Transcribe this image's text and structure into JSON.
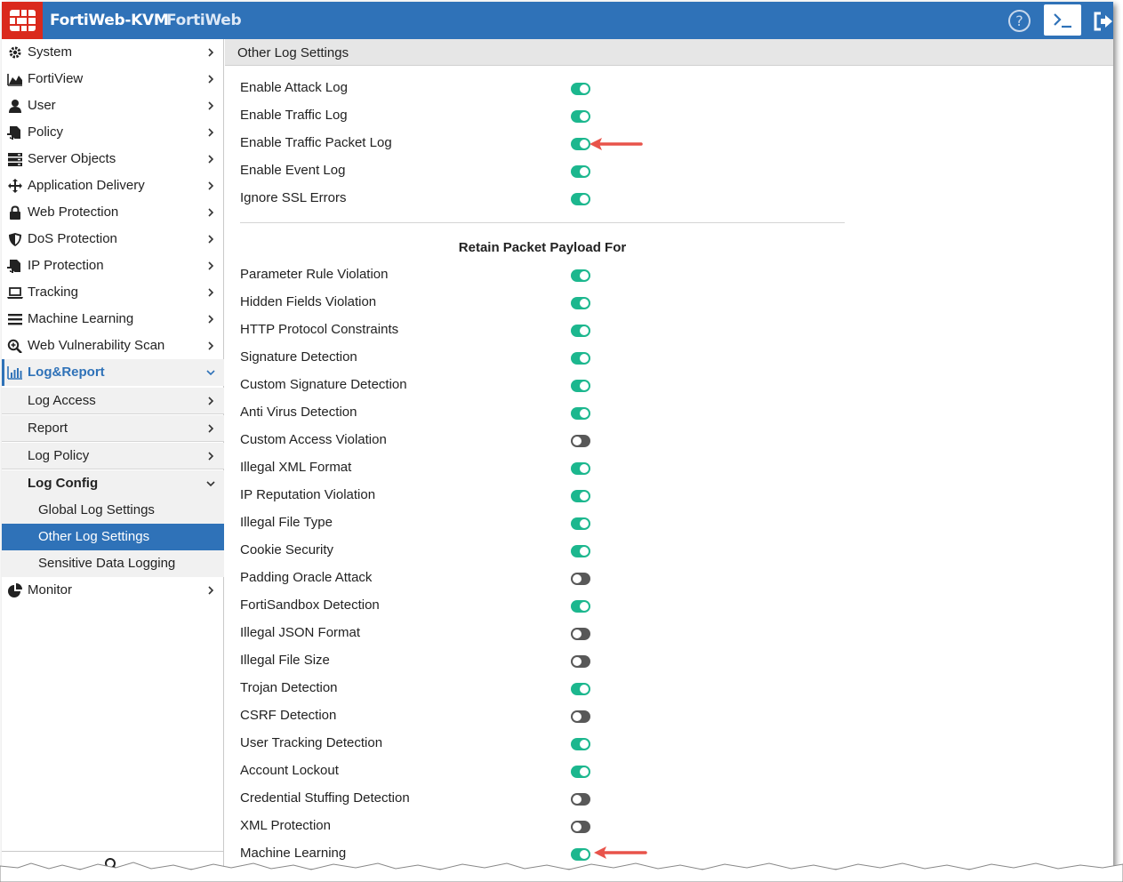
{
  "header": {
    "app_title": "FortiWeb-KVM",
    "app_sub": "FortiWeb",
    "help_glyph": "?",
    "colors": {
      "bar": "#2f72b8",
      "logo": "#da291c",
      "toggle_on": "#1cb78e",
      "toggle_off": "#585858",
      "selected": "#2f72b8"
    }
  },
  "sidebar": {
    "items": [
      {
        "label": "System",
        "icon": "gear-icon"
      },
      {
        "label": "FortiView",
        "icon": "area-chart-icon"
      },
      {
        "label": "User",
        "icon": "user-icon"
      },
      {
        "label": "Policy",
        "icon": "policy-icon"
      },
      {
        "label": "Server Objects",
        "icon": "server-icon"
      },
      {
        "label": "Application Delivery",
        "icon": "move-arrows-icon"
      },
      {
        "label": "Web Protection",
        "icon": "lock-icon"
      },
      {
        "label": "DoS Protection",
        "icon": "shield-icon"
      },
      {
        "label": "IP Protection",
        "icon": "ip-policy-icon"
      },
      {
        "label": "Tracking",
        "icon": "laptop-icon"
      },
      {
        "label": "Machine Learning",
        "icon": "hamburger-icon"
      },
      {
        "label": "Web Vulnerability Scan",
        "icon": "magnifier-plus-icon"
      },
      {
        "label": "Log&Report",
        "icon": "bar-chart-icon"
      }
    ],
    "sub_items": [
      "Log Access",
      "Report",
      "Log Policy",
      "Log Config"
    ],
    "log_config_children": [
      "Global Log Settings",
      "Other Log Settings",
      "Sensitive Data Logging"
    ],
    "monitor_label": "Monitor"
  },
  "main": {
    "page_title": "Other Log Settings",
    "general": [
      {
        "label": "Enable Attack Log",
        "on": true
      },
      {
        "label": "Enable Traffic Log",
        "on": true
      },
      {
        "label": "Enable Traffic Packet Log",
        "on": true
      },
      {
        "label": "Enable Event Log",
        "on": true
      },
      {
        "label": "Ignore SSL Errors",
        "on": true
      }
    ],
    "section_title": "Retain Packet Payload For",
    "payload": [
      {
        "label": "Parameter Rule Violation",
        "on": true
      },
      {
        "label": "Hidden Fields Violation",
        "on": true
      },
      {
        "label": "HTTP Protocol Constraints",
        "on": true
      },
      {
        "label": "Signature Detection",
        "on": true
      },
      {
        "label": "Custom Signature Detection",
        "on": true
      },
      {
        "label": "Anti Virus Detection",
        "on": true
      },
      {
        "label": "Custom Access Violation",
        "on": false
      },
      {
        "label": "Illegal XML Format",
        "on": true
      },
      {
        "label": "IP Reputation Violation",
        "on": true
      },
      {
        "label": "Illegal File Type",
        "on": true
      },
      {
        "label": "Cookie Security",
        "on": true
      },
      {
        "label": "Padding Oracle Attack",
        "on": false
      },
      {
        "label": "FortiSandbox Detection",
        "on": true
      },
      {
        "label": "Illegal JSON Format",
        "on": false
      },
      {
        "label": "Illegal File Size",
        "on": false
      },
      {
        "label": "Trojan Detection",
        "on": true
      },
      {
        "label": "CSRF Detection",
        "on": false
      },
      {
        "label": "User Tracking Detection",
        "on": true
      },
      {
        "label": "Account Lockout",
        "on": true
      },
      {
        "label": "Credential Stuffing Detection",
        "on": false
      },
      {
        "label": "XML Protection",
        "on": false
      },
      {
        "label": "Machine Learning",
        "on": true
      }
    ]
  }
}
